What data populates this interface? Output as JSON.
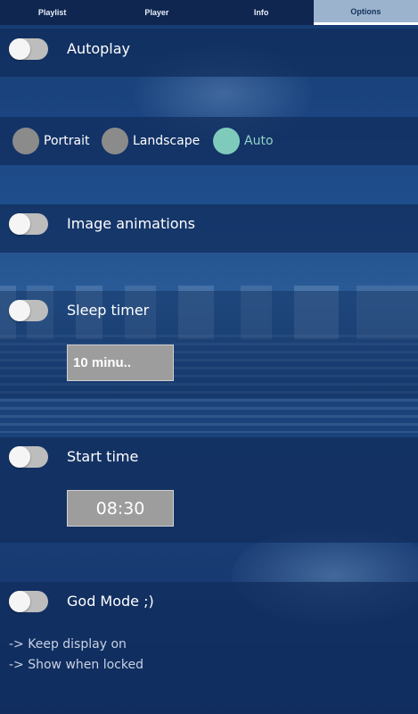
{
  "tabs": [
    {
      "label": "Playlist",
      "active": false
    },
    {
      "label": "Player",
      "active": false
    },
    {
      "label": "Info",
      "active": false
    },
    {
      "label": "Options",
      "active": true
    }
  ],
  "settings": {
    "autoplay": {
      "label": "Autoplay",
      "enabled": false
    },
    "orientation": {
      "options": [
        "Portrait",
        "Landscape",
        "Auto"
      ],
      "selected": "Auto"
    },
    "image_animations": {
      "label": "Image animations",
      "enabled": false
    },
    "sleep_timer": {
      "label": "Sleep timer",
      "enabled": false,
      "value": "10 minu.."
    },
    "start_time": {
      "label": "Start time",
      "enabled": false,
      "value": "08:30"
    },
    "god_mode": {
      "label": "God Mode ;)",
      "enabled": false,
      "notes": [
        "-> Keep display on",
        "-> Show when locked"
      ]
    }
  },
  "colors": {
    "accent": "#7ecbbc",
    "tab_active_bg": "#9bb3cc",
    "switch_off": "#bdbdbd",
    "row_bg": "#102c5c"
  }
}
